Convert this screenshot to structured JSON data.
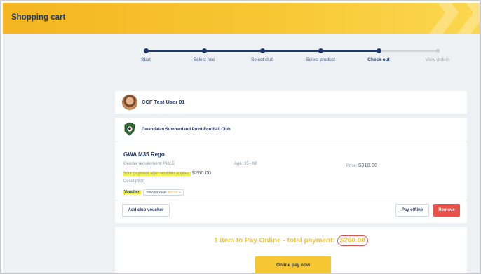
{
  "header": {
    "title": "Shopping cart"
  },
  "stepper": {
    "steps": [
      {
        "label": "Start",
        "state": "done"
      },
      {
        "label": "Select role",
        "state": "done"
      },
      {
        "label": "Select club",
        "state": "done"
      },
      {
        "label": "Select product",
        "state": "done"
      },
      {
        "label": "Check out",
        "state": "active"
      },
      {
        "label": "View orders",
        "state": "pending"
      }
    ]
  },
  "user": {
    "name": "CCF Test User 01"
  },
  "club": {
    "name": "Gwandalan Summerland Point Football Club"
  },
  "product": {
    "title": "GWA M35 Rego",
    "gender_requirement": "Gender requirement: MALE",
    "age": "Age: 35 - 99",
    "price_label": "Price:",
    "price": "$310.00",
    "payment_after_voucher_label": "Your payment after voucher applied:",
    "payment_after_voucher": "$260.00",
    "description_label": "Description",
    "voucher_label": "Voucher:",
    "voucher_code": "GWA 50 Youth",
    "voucher_value": "$50.00",
    "voucher_remove": "×"
  },
  "buttons": {
    "add_club_voucher": "Add club voucher",
    "pay_offline": "Pay offline",
    "remove": "Remove",
    "online_pay_now": "Online pay now"
  },
  "summary": {
    "text": "1 item to Pay Online - total payment:",
    "total": "$260.00"
  },
  "colors": {
    "brand_navy": "#1f3a68",
    "brand_yellow": "#f7c733",
    "danger_red": "#e5534b",
    "highlight": "#f6ef3c"
  }
}
